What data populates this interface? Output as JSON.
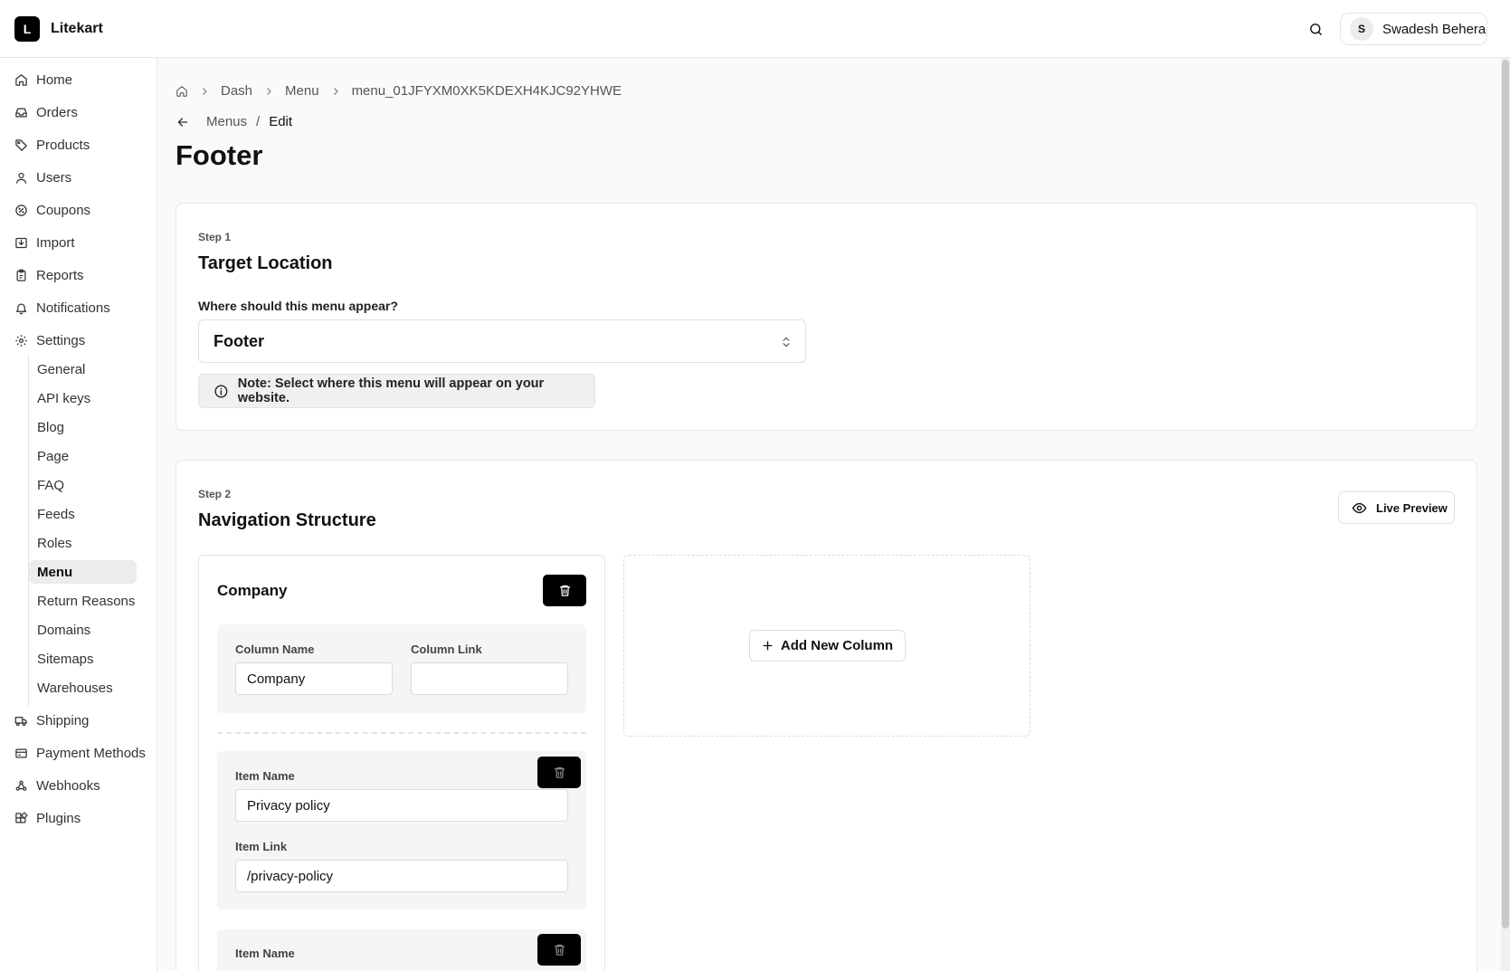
{
  "app": {
    "logo_letter": "L",
    "name": "Litekart"
  },
  "header": {
    "user_initial": "S",
    "user_name": "Swadesh Behera"
  },
  "sidebar": {
    "items": [
      {
        "label": "Home",
        "icon": "home-icon"
      },
      {
        "label": "Orders",
        "icon": "inbox-icon"
      },
      {
        "label": "Products",
        "icon": "tag-icon"
      },
      {
        "label": "Users",
        "icon": "user-icon"
      },
      {
        "label": "Coupons",
        "icon": "percent-badge-icon"
      },
      {
        "label": "Import",
        "icon": "import-icon"
      },
      {
        "label": "Reports",
        "icon": "clipboard-icon"
      },
      {
        "label": "Notifications",
        "icon": "bell-icon"
      },
      {
        "label": "Settings",
        "icon": "gear-icon"
      }
    ],
    "settings_sub": [
      "General",
      "API keys",
      "Blog",
      "Page",
      "FAQ",
      "Feeds",
      "Roles",
      "Menu",
      "Return Reasons",
      "Domains",
      "Sitemaps",
      "Warehouses"
    ],
    "active_sub": "Menu",
    "bottom_items": [
      {
        "label": "Shipping",
        "icon": "truck-icon"
      },
      {
        "label": "Payment Methods",
        "icon": "payment-icon"
      },
      {
        "label": "Webhooks",
        "icon": "webhook-icon"
      },
      {
        "label": "Plugins",
        "icon": "puzzle-icon"
      }
    ]
  },
  "breadcrumb": {
    "items": [
      "Dash",
      "Menu",
      "menu_01JFYXM0XK5KDEXH4KJC92YHWE"
    ]
  },
  "subcrumb": {
    "parent": "Menus",
    "separator": "/",
    "current": "Edit"
  },
  "page": {
    "title": "Footer"
  },
  "step1": {
    "label": "Step 1",
    "title": "Target Location",
    "question": "Where should this menu appear?",
    "selected": "Footer",
    "note": "Note: Select where this menu will appear on your website."
  },
  "step2": {
    "label": "Step 2",
    "title": "Navigation Structure",
    "preview_label": "Live Preview",
    "add_column_label": "Add New Column",
    "column": {
      "title": "Company",
      "name_label": "Column Name",
      "name_value": "Company",
      "link_label": "Column Link",
      "link_value": "",
      "items": [
        {
          "name_label": "Item Name",
          "name_value": "Privacy policy",
          "link_label": "Item Link",
          "link_value": "/privacy-policy"
        },
        {
          "name_label": "Item Name"
        }
      ]
    }
  }
}
